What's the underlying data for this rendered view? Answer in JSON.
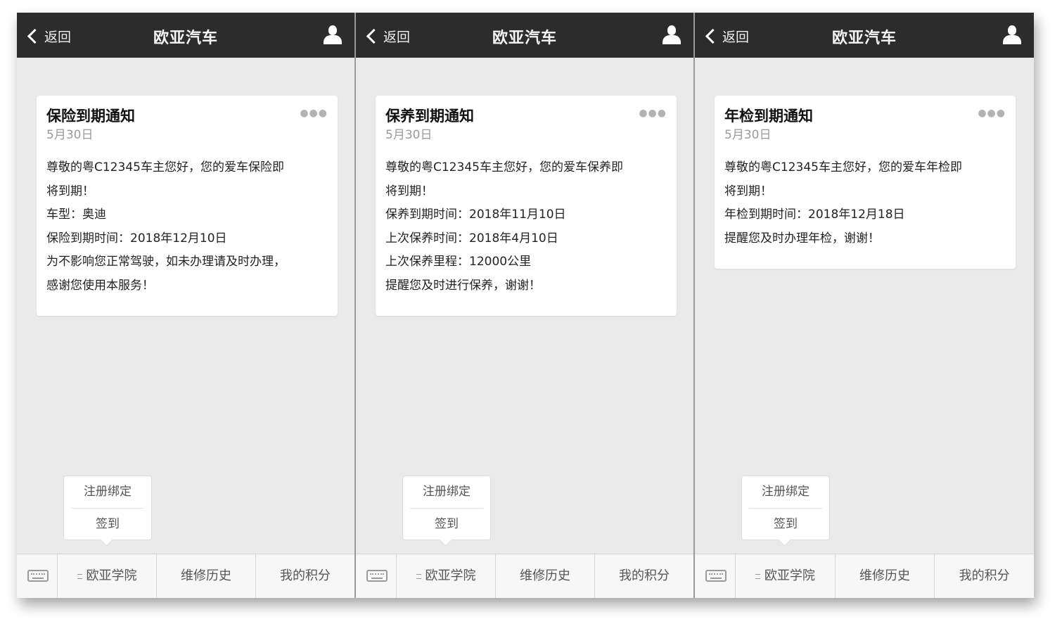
{
  "screens": [
    {
      "header": {
        "back_label": "返回",
        "title": "欧亚汽车"
      },
      "card": {
        "title": "保险到期通知",
        "date": "5月30日",
        "lines": [
          "尊敬的粤C12345车主您好，您的爱车保险即",
          "将到期！",
          "车型：奥迪",
          "保险到期时间：2018年12月10日",
          "为不影响您正常驾驶，如未办理请及时办理，",
          "感谢您使用本服务！"
        ]
      },
      "popup": {
        "items": [
          "注册绑定",
          "签到"
        ]
      },
      "bottom_menu": [
        "欧亚学院",
        "维修历史",
        "我的积分"
      ]
    },
    {
      "header": {
        "back_label": "返回",
        "title": "欧亚汽车"
      },
      "card": {
        "title": "保养到期通知",
        "date": "5月30日",
        "lines": [
          "尊敬的粤C12345车主您好，您的爱车保养即",
          "将到期！",
          "保养到期时间：2018年11月10日",
          "上次保养时间：2018年4月10日",
          "上次保养里程：12000公里",
          "提醒您及时进行保养，谢谢！"
        ]
      },
      "popup": {
        "items": [
          "注册绑定",
          "签到"
        ]
      },
      "bottom_menu": [
        "欧亚学院",
        "维修历史",
        "我的积分"
      ]
    },
    {
      "header": {
        "back_label": "返回",
        "title": "欧亚汽车"
      },
      "card": {
        "title": "年检到期通知",
        "date": "5月30日",
        "lines": [
          "尊敬的粤C12345车主您好，您的爱车年检即",
          "将到期！",
          "年检到期时间：2018年12月18日",
          "提醒您及时办理年检，谢谢！"
        ]
      },
      "popup": {
        "items": [
          "注册绑定",
          "签到"
        ]
      },
      "bottom_menu": [
        "欧亚学院",
        "维修历史",
        "我的积分"
      ]
    }
  ]
}
